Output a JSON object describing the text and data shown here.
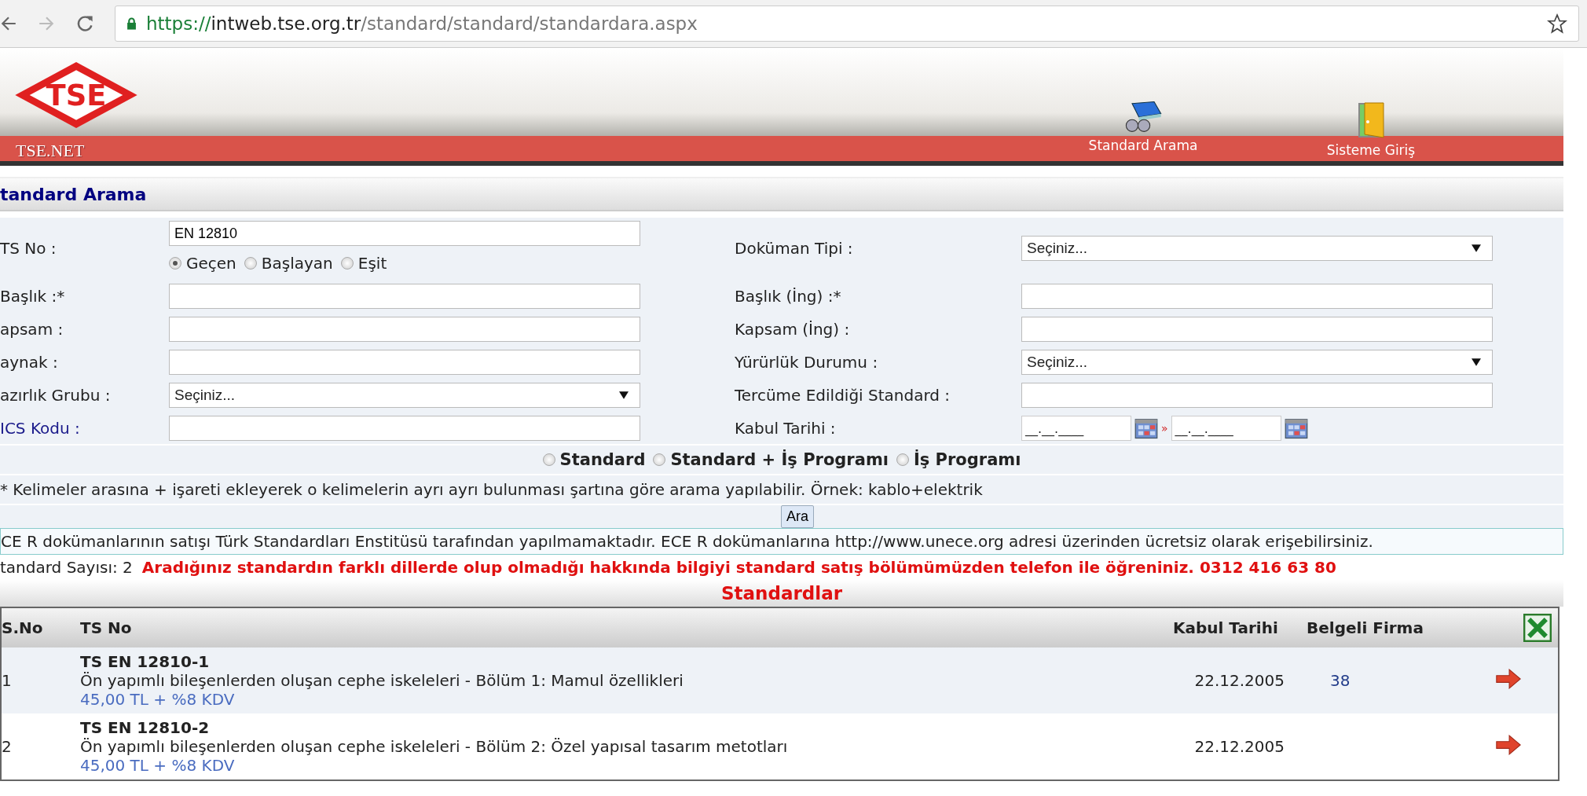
{
  "browser": {
    "url": {
      "scheme": "https://",
      "host": "intweb.tse.org.tr",
      "path": "/standard/standard/standardara.aspx"
    }
  },
  "header": {
    "logo_text": "TSE",
    "brand": "TSE.NET",
    "nav": [
      {
        "label": "Standard Arama"
      },
      {
        "label": "Sisteme Giriş"
      }
    ]
  },
  "section_title": "tandard Arama",
  "form": {
    "rows": [
      {
        "left": {
          "label": "TS No :",
          "kind": "tsno",
          "value": "EN 12810",
          "options": [
            {
              "label": "Geçen",
              "selected": true
            },
            {
              "label": "Başlayan",
              "selected": false
            },
            {
              "label": "Eşit",
              "selected": false
            }
          ]
        },
        "right": {
          "label": "Doküman Tipi :",
          "kind": "select",
          "value": "Seçiniz..."
        }
      },
      {
        "left": {
          "label": "Başlık :*",
          "kind": "text"
        },
        "right": {
          "label": "Başlık (İng) :*",
          "kind": "text"
        }
      },
      {
        "left": {
          "label": "apsam :",
          "kind": "text"
        },
        "right": {
          "label": "Kapsam (İng) :",
          "kind": "text"
        }
      },
      {
        "left": {
          "label": "aynak :",
          "kind": "text"
        },
        "right": {
          "label": "Yürürlük Durumu :",
          "kind": "select",
          "value": "Seçiniz..."
        }
      },
      {
        "left": {
          "label": "azırlık Grubu :",
          "kind": "select",
          "value": "Seçiniz..."
        },
        "right": {
          "label": "Tercüme Edildiği Standard :",
          "kind": "text"
        }
      },
      {
        "left": {
          "label": "ICS Kodu :",
          "kind": "text",
          "link": true
        },
        "right": {
          "label": "Kabul Tarihi :",
          "kind": "daterange",
          "value_from": "__.__.____",
          "separator": "»",
          "value_to": "__.__.____"
        }
      }
    ],
    "scope_options": [
      {
        "label": "Standard",
        "selected": false
      },
      {
        "label": "Standard + İş Programı",
        "selected": false
      },
      {
        "label": "İş Programı",
        "selected": false
      }
    ],
    "hint": "* Kelimeler arasına + işareti ekleyerek o kelimelerin ayrı ayrı bulunması şartına göre arama yapılabilir. Örnek: kablo+elektrik",
    "search_button": "Ara"
  },
  "notice": "CE R dokümanlarının satışı Türk Standardları Enstitüsü tarafından yapılmamaktadır. ECE R dokümanlarına http://www.unece.org adresi üzerinden ücretsiz olarak erişebilirsiniz.",
  "count": "tandard Sayısı: 2",
  "warning": "Aradığınız standardın farklı dillerde olup olmadığı hakkında bilgiyi standard satış bölümümüzden telefon ile öğreniniz. 0312 416 63 80",
  "results": {
    "title": "Standardlar",
    "columns": [
      "S.No",
      "TS No",
      "Kabul Tarihi",
      "Belgeli Firma"
    ],
    "rows": [
      {
        "no": "1",
        "code": "TS EN 12810-1",
        "title": "Ön yapımlı bileşenlerden oluşan cephe iskeleleri - Bölüm 1: Mamul özellikleri",
        "price": "45,00 TL + %8 KDV",
        "date": "22.12.2005",
        "firms": "38"
      },
      {
        "no": "2",
        "code": "TS EN 12810-2",
        "title": "Ön yapımlı bileşenlerden oluşan cephe iskeleleri - Bölüm 2: Özel yapısal tasarım metotları",
        "price": "45,00 TL + %8 KDV",
        "date": "22.12.2005"
      }
    ]
  }
}
